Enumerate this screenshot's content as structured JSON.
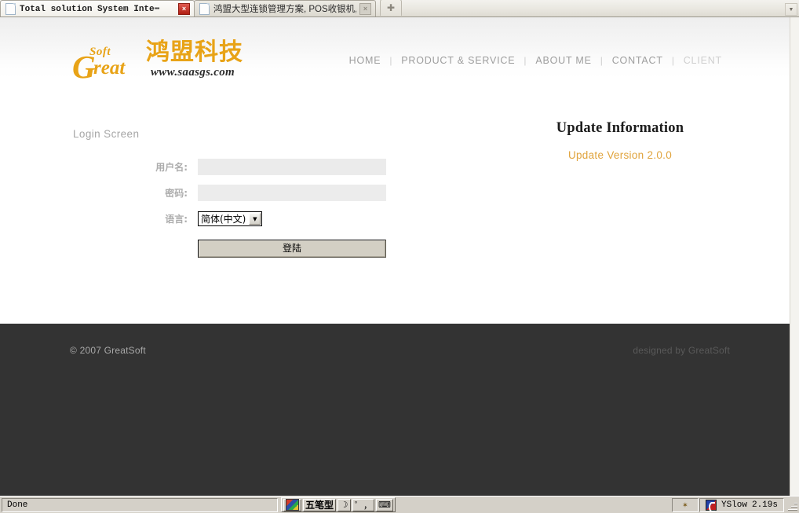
{
  "browser": {
    "tabs": [
      {
        "title": "Total solution System Inte⋯",
        "active": true,
        "close_label": "×",
        "favicon": "page-icon"
      },
      {
        "title": "鸿盟大型连锁管理方案, POS收银机, ⋯",
        "active": false,
        "close_label": "×",
        "favicon": "page-icon"
      }
    ],
    "new_tab_label": "✚",
    "tab_list_label": "▼"
  },
  "site": {
    "logo": {
      "soft": "Soft",
      "g": "G",
      "reat": "reat",
      "chinese": "鸿盟科技",
      "url": "www.saasgs.com",
      "accent_color": "#e8a317"
    },
    "nav": {
      "separator": "|",
      "items": [
        {
          "label": "HOME",
          "dim": false
        },
        {
          "label": "PRODUCT & SERVICE",
          "dim": false
        },
        {
          "label": "ABOUT ME",
          "dim": false
        },
        {
          "label": "CONTACT",
          "dim": false
        },
        {
          "label": "CLIENT",
          "dim": true
        }
      ]
    }
  },
  "login": {
    "screen_title": "Login Screen",
    "fields": {
      "username": {
        "label": "用户名:",
        "value": "",
        "placeholder": ""
      },
      "password": {
        "label": "密码:",
        "value": "",
        "placeholder": ""
      },
      "language": {
        "label": "语言:",
        "selected": "简体(中文)",
        "arrow": "▼",
        "options": [
          "简体(中文)"
        ]
      }
    },
    "submit_label": "登陆"
  },
  "update": {
    "title": "Update Information",
    "version_text": "Update Version 2.0.0",
    "version_color": "#e0a33c"
  },
  "footer": {
    "copyright": "© 2007 GreatSoft",
    "credit": "designed by GreatSoft"
  },
  "statusbar": {
    "status_text": "Done",
    "ime": {
      "logo_name": "ime-logo-icon",
      "method": "五笔型",
      "shape_btn": "☽",
      "punct_btn": "゜，",
      "keyboard_btn": "⌨"
    },
    "bug_icon": "✶",
    "yslow_label": "YSlow",
    "yslow_time": "2.19s",
    "resize_grip": "resize-grip"
  }
}
